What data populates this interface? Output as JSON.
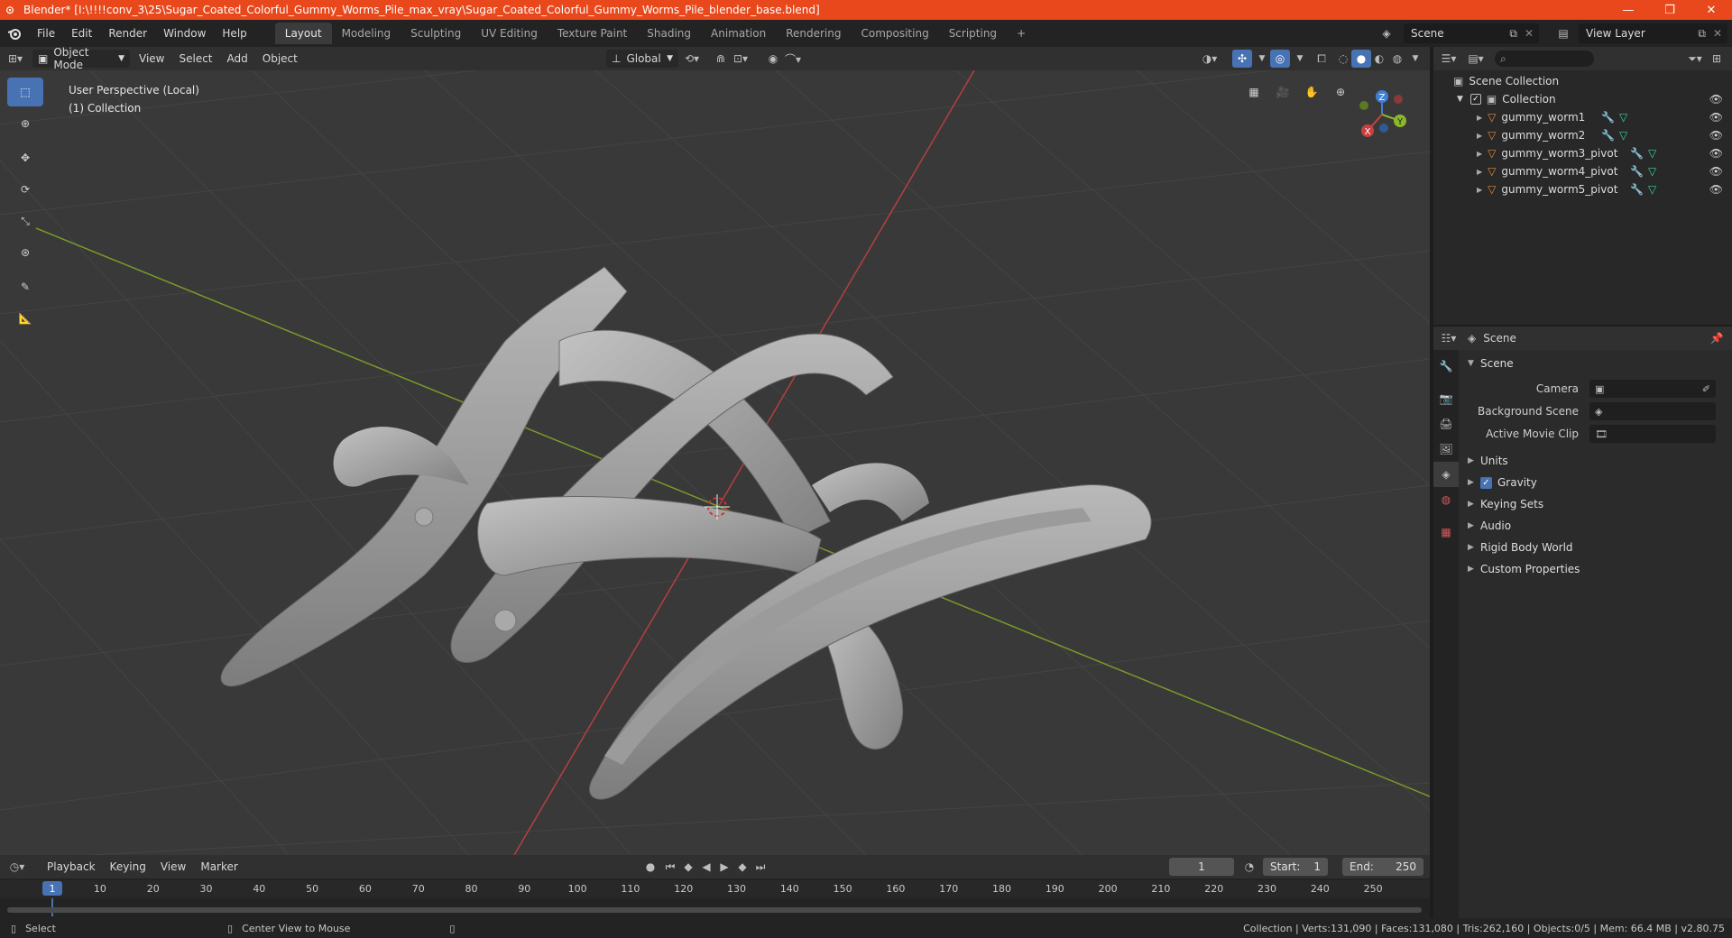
{
  "window": {
    "title": "Blender* [I:\\!!!!conv_3\\25\\Sugar_Coated_Colorful_Gummy_Worms_Pile_max_vray\\Sugar_Coated_Colorful_Gummy_Worms_Pile_blender_base.blend]",
    "minimize": "—",
    "maximize": "❐",
    "close": "✕"
  },
  "menu": [
    "File",
    "Edit",
    "Render",
    "Window",
    "Help"
  ],
  "workspaces": [
    "Layout",
    "Modeling",
    "Sculpting",
    "UV Editing",
    "Texture Paint",
    "Shading",
    "Animation",
    "Rendering",
    "Compositing",
    "Scripting"
  ],
  "scene_selector": {
    "scene": "Scene",
    "view_layer": "View Layer"
  },
  "viewport_header": {
    "mode": "Object Mode",
    "menus": [
      "View",
      "Select",
      "Add",
      "Object"
    ],
    "transform_orientation": "Global"
  },
  "viewport": {
    "perspective_label": "User Perspective (Local)",
    "collection_label": "(1) Collection",
    "axes": {
      "x": "X",
      "y": "Y",
      "z": "Z"
    }
  },
  "outliner": {
    "root": "Scene Collection",
    "collection": "Collection",
    "objects": [
      "gummy_worm1",
      "gummy_worm2",
      "gummy_worm3_pivot",
      "gummy_worm4_pivot",
      "gummy_worm5_pivot"
    ]
  },
  "properties": {
    "breadcrumb": "Scene",
    "panel_title": "Scene",
    "fields": [
      {
        "label": "Camera"
      },
      {
        "label": "Background Scene"
      },
      {
        "label": "Active Movie Clip"
      }
    ],
    "subpanels": [
      "Units",
      "Gravity",
      "Keying Sets",
      "Audio",
      "Rigid Body World",
      "Custom Properties"
    ]
  },
  "timeline": {
    "menus": [
      "Playback",
      "Keying",
      "View",
      "Marker"
    ],
    "current_frame": "1",
    "start_label": "Start:",
    "start": "1",
    "end_label": "End:",
    "end": "250",
    "ruler": [
      "1",
      "10",
      "20",
      "30",
      "40",
      "50",
      "60",
      "70",
      "80",
      "90",
      "100",
      "110",
      "120",
      "130",
      "140",
      "150",
      "160",
      "170",
      "180",
      "190",
      "200",
      "210",
      "220",
      "230",
      "240",
      "250"
    ]
  },
  "statusbar": {
    "left": "Select",
    "middle": "Center View to Mouse",
    "right": "Collection | Verts:131,090 | Faces:131,080 | Tris:262,160 | Objects:0/5 | Mem: 66.4 MB | v2.80.75"
  },
  "colors": {
    "titlebar": "#e8481c",
    "accent": "#4772b3",
    "axis_x": "#c94040",
    "axis_y": "#8ab829",
    "axis_z": "#3f7fd6",
    "mesh_orange": "#e08a3c"
  }
}
